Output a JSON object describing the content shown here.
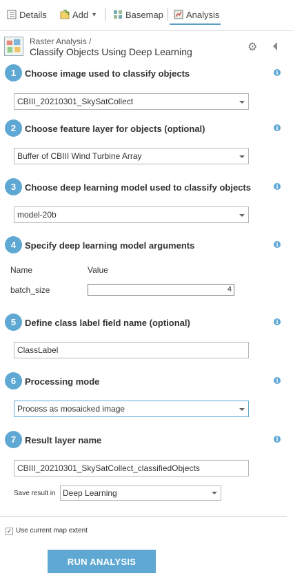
{
  "toolbar": {
    "details": "Details",
    "add": "Add",
    "basemap": "Basemap",
    "analysis": "Analysis"
  },
  "header": {
    "breadcrumb": "Raster Analysis /",
    "title": "Classify Objects Using Deep Learning"
  },
  "steps": [
    {
      "number": "1",
      "label": "Choose image used to classify objects",
      "value": "CBIII_20210301_SkySatCollect"
    },
    {
      "number": "2",
      "label": "Choose feature layer for objects (optional)",
      "value": "Buffer of CBIII Wind Turbine Array"
    },
    {
      "number": "3",
      "label": "Choose deep learning model used to classify objects",
      "value": "model-20b"
    },
    {
      "number": "4",
      "label": "Specify deep learning model arguments"
    },
    {
      "number": "5",
      "label": "Define class label field name (optional)",
      "value": "ClassLabel"
    },
    {
      "number": "6",
      "label": "Processing mode",
      "value": "Process as mosaicked image"
    },
    {
      "number": "7",
      "label": "Result layer name",
      "value": "CBIII_20210301_SkySatCollect_classifiedObjects"
    }
  ],
  "arguments": {
    "name_header": "Name",
    "value_header": "Value",
    "rows": [
      {
        "name": "batch_size",
        "value": "4"
      }
    ]
  },
  "save": {
    "label": "Save result in",
    "value": "Deep Learning"
  },
  "extent": {
    "label": "Use current map extent",
    "checked": true,
    "check_mark": "✓"
  },
  "run_button": "RUN ANALYSIS",
  "icons": {
    "info": "i",
    "gear": "⚙",
    "grip": "⋮"
  },
  "colors": {
    "accent": "#5fa8d3"
  }
}
